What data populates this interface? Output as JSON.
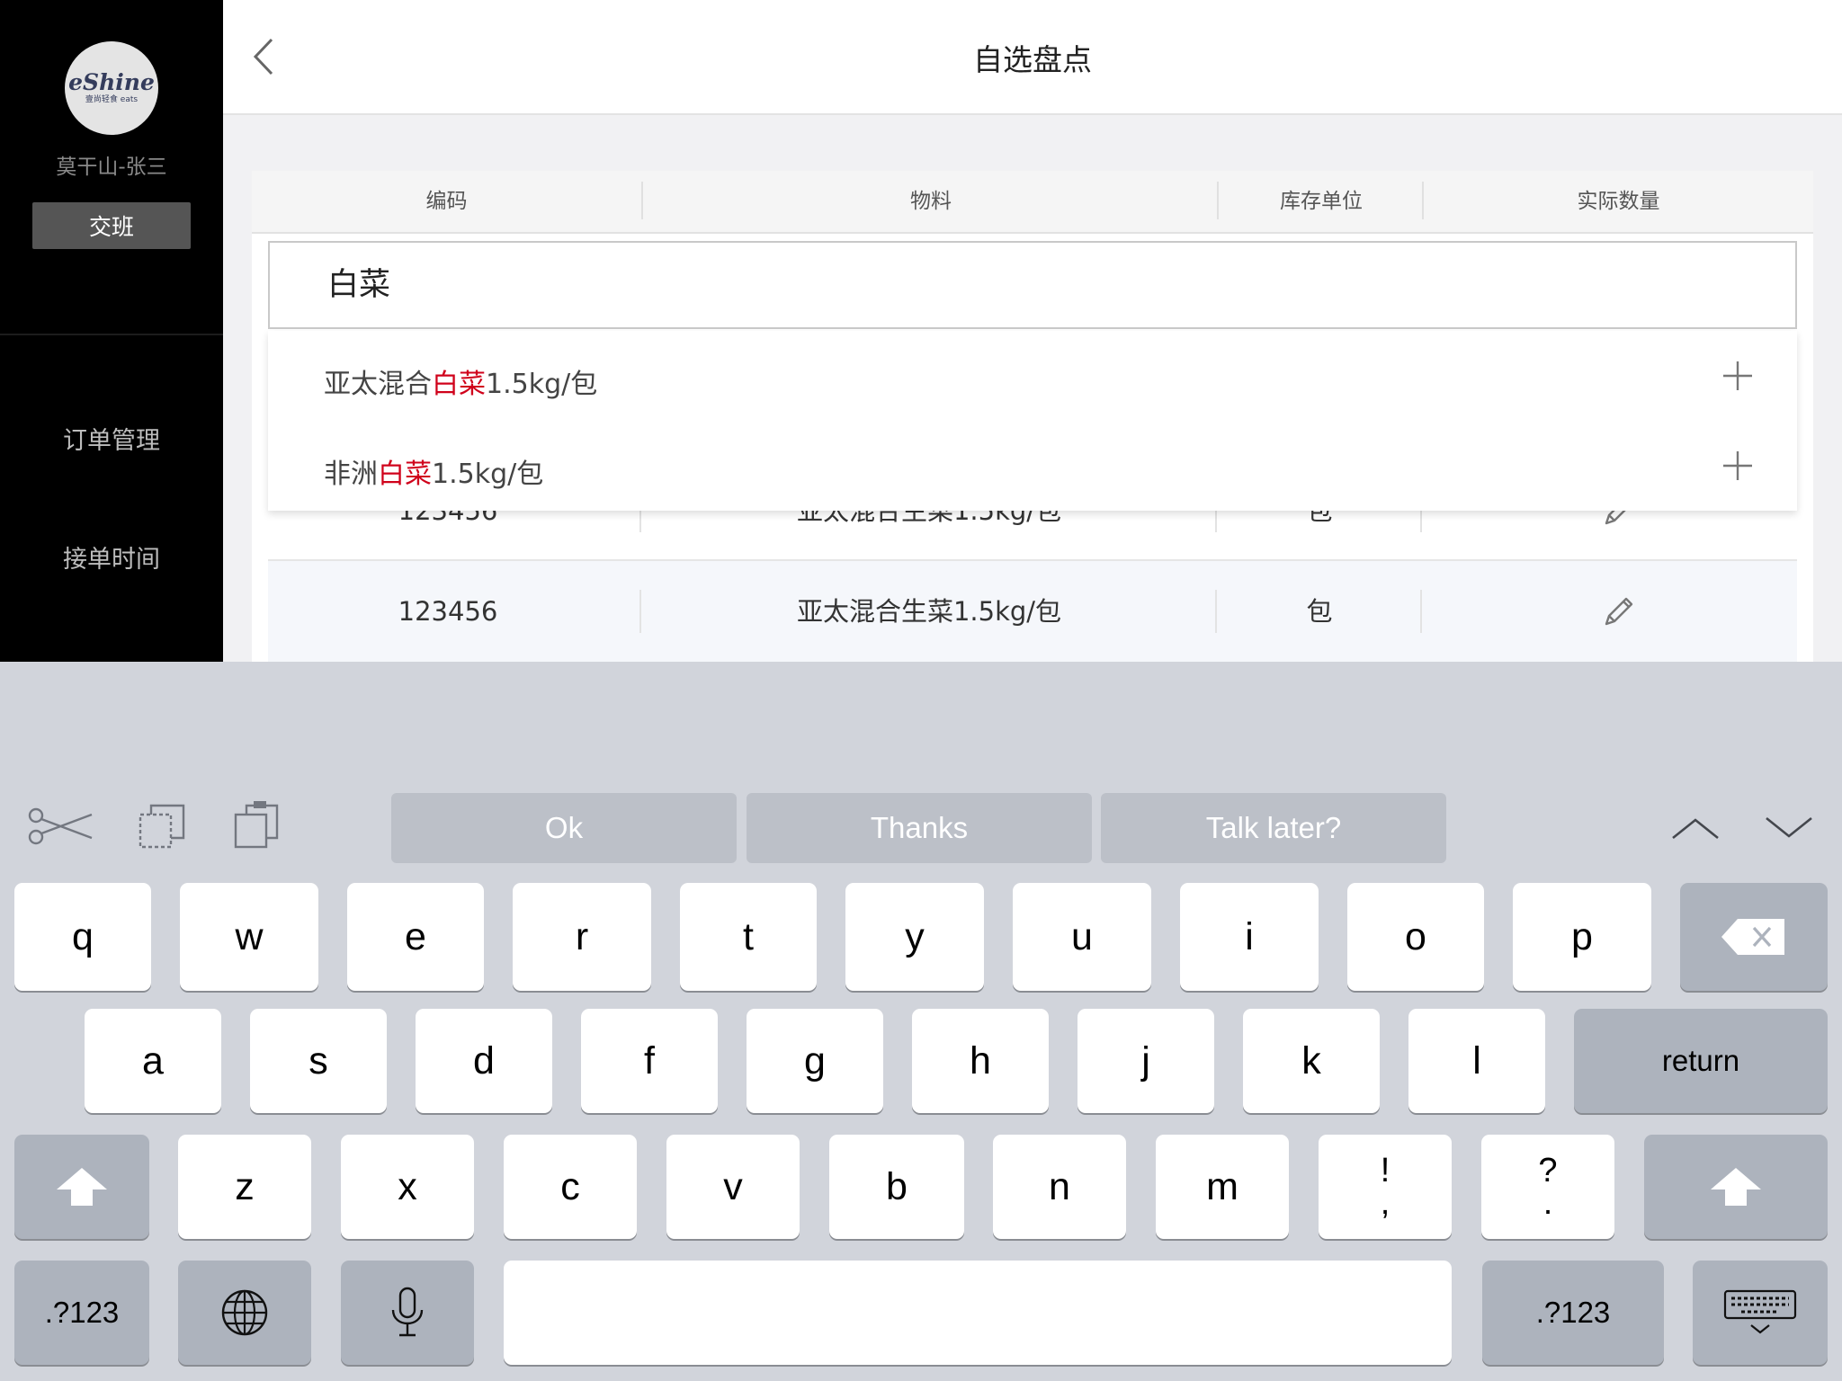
{
  "sidebar": {
    "logo_text": "eShine",
    "logo_sub": "壹尚轻食 eats",
    "user": "莫干山-张三",
    "shift_button": "交班",
    "nav": [
      {
        "label": "订单管理"
      },
      {
        "label": "接单时间"
      }
    ]
  },
  "header": {
    "title": "自选盘点"
  },
  "table": {
    "columns": [
      "编码",
      "物料",
      "库存单位",
      "实际数量"
    ],
    "rows": [
      {
        "code": "123456",
        "material": "亚太混合生菜1.5kg/包",
        "unit": "包"
      },
      {
        "code": "123456",
        "material": "亚太混合生菜1.5kg/包",
        "unit": "包"
      }
    ]
  },
  "search": {
    "value": "白菜",
    "suggestions": [
      {
        "prefix": "亚太混合",
        "match": "白菜",
        "suffix": "1.5kg/包"
      },
      {
        "prefix": "非洲",
        "match": "白菜",
        "suffix": "1.5kg/包"
      }
    ]
  },
  "keyboard": {
    "predictions": [
      "Ok",
      "Thanks",
      "Talk later?"
    ],
    "row1": [
      "q",
      "w",
      "e",
      "r",
      "t",
      "y",
      "u",
      "i",
      "o",
      "p"
    ],
    "row2": [
      "a",
      "s",
      "d",
      "f",
      "g",
      "h",
      "j",
      "k",
      "l"
    ],
    "row3": [
      "z",
      "x",
      "c",
      "v",
      "b",
      "n",
      "m"
    ],
    "punct1": {
      "top": "!",
      "bottom": ","
    },
    "punct2": {
      "top": "?",
      "bottom": "."
    },
    "return_label": "return",
    "numbers_label": ".?123",
    "icons": [
      "scissors-icon",
      "copy-icon",
      "paste-icon",
      "chevron-up-icon",
      "chevron-down-icon",
      "backspace-icon",
      "shift-icon",
      "globe-icon",
      "microphone-icon",
      "keyboard-dismiss-icon"
    ]
  },
  "colors": {
    "highlight": "#d0021b",
    "sidebar_bg": "#000000",
    "keyboard_bg": "#d1d4db",
    "prediction_bg": "#bcc0c8"
  }
}
